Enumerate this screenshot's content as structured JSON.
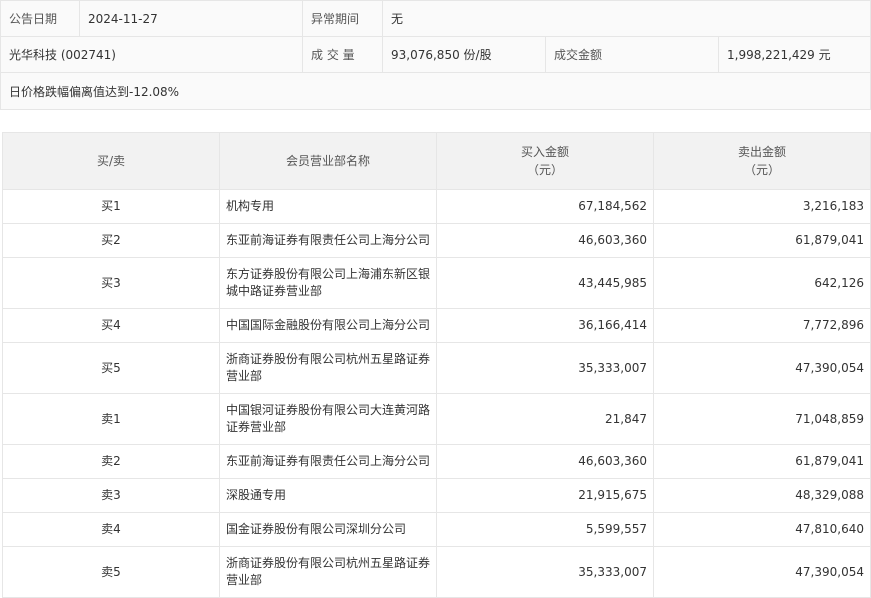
{
  "summary": {
    "date_label": "公告日期",
    "date_value": "2024-11-27",
    "period_label": "异常期间",
    "period_value": "无",
    "stock": "光华科技 (002741)",
    "volume_label": "成 交 量",
    "volume_value": "93,076,850 份/股",
    "amount_label": "成交金额",
    "amount_value": "1,998,221,429 元",
    "reason": "日价格跌幅偏离值达到-12.08%"
  },
  "table": {
    "headers": {
      "side": "买/卖",
      "branch": "会员营业部名称",
      "buy_line1": "买入金额",
      "buy_line2": "（元）",
      "sell_line1": "卖出金额",
      "sell_line2": "（元）"
    },
    "rows": [
      {
        "side": "买1",
        "branch": "机构专用",
        "buy": "67,184,562",
        "sell": "3,216,183"
      },
      {
        "side": "买2",
        "branch": "东亚前海证券有限责任公司上海分公司",
        "buy": "46,603,360",
        "sell": "61,879,041"
      },
      {
        "side": "买3",
        "branch": "东方证券股份有限公司上海浦东新区银城中路证券营业部",
        "buy": "43,445,985",
        "sell": "642,126"
      },
      {
        "side": "买4",
        "branch": "中国国际金融股份有限公司上海分公司",
        "buy": "36,166,414",
        "sell": "7,772,896"
      },
      {
        "side": "买5",
        "branch": "浙商证券股份有限公司杭州五星路证券营业部",
        "buy": "35,333,007",
        "sell": "47,390,054"
      },
      {
        "side": "卖1",
        "branch": "中国银河证券股份有限公司大连黄河路证券营业部",
        "buy": "21,847",
        "sell": "71,048,859"
      },
      {
        "side": "卖2",
        "branch": "东亚前海证券有限责任公司上海分公司",
        "buy": "46,603,360",
        "sell": "61,879,041"
      },
      {
        "side": "卖3",
        "branch": "深股通专用",
        "buy": "21,915,675",
        "sell": "48,329,088"
      },
      {
        "side": "卖4",
        "branch": "国金证券股份有限公司深圳分公司",
        "buy": "5,599,557",
        "sell": "47,810,640"
      },
      {
        "side": "卖5",
        "branch": "浙商证券股份有限公司杭州五星路证券营业部",
        "buy": "35,333,007",
        "sell": "47,390,054"
      }
    ]
  }
}
